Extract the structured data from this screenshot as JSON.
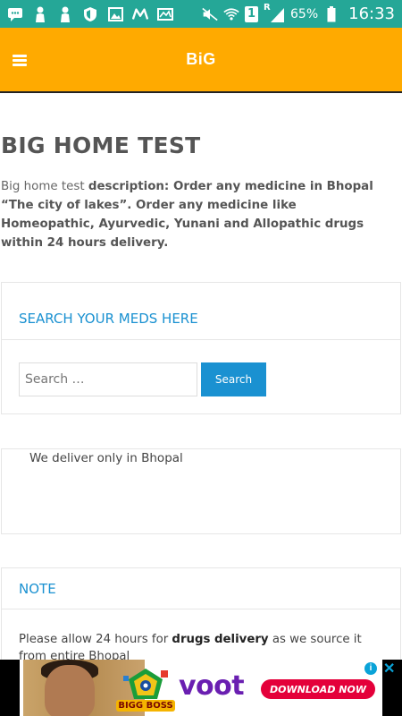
{
  "status_bar": {
    "sim_number": "1",
    "roaming": "R",
    "battery": "65%",
    "time": "16:33"
  },
  "header": {
    "title": "BiG"
  },
  "main": {
    "page_title": "BIG HOME TEST",
    "description_lead": "Big home test ",
    "description_bold": "description: Order any medicine in Bhopal “The city of lakes”. Order any medicine like Homeopathic, Ayurvedic, Yunani and Allopathic drugs within 24 hours delivery."
  },
  "search_widget": {
    "title": "SEARCH YOUR MEDS HERE",
    "placeholder": "Search …",
    "button_label": "Search"
  },
  "deliver_widget": {
    "text": "We deliver only in Bhopal"
  },
  "note_widget": {
    "title": "NOTE",
    "text_pre": "Please allow 24 hours for ",
    "text_bold": "drugs delivery",
    "text_post": " as we source it from entire Bhopal"
  },
  "ad": {
    "badge_text": "BIGG BOSS",
    "brand": "voot",
    "cta": "DOWNLOAD NOW",
    "info_label": "i",
    "close_label": "✕"
  },
  "colors": {
    "status_bar": "#25a797",
    "header": "#ffaa00",
    "accent": "#1a91d1",
    "ad_cta": "#e4003a",
    "ad_brand": "#6a1fb1"
  }
}
